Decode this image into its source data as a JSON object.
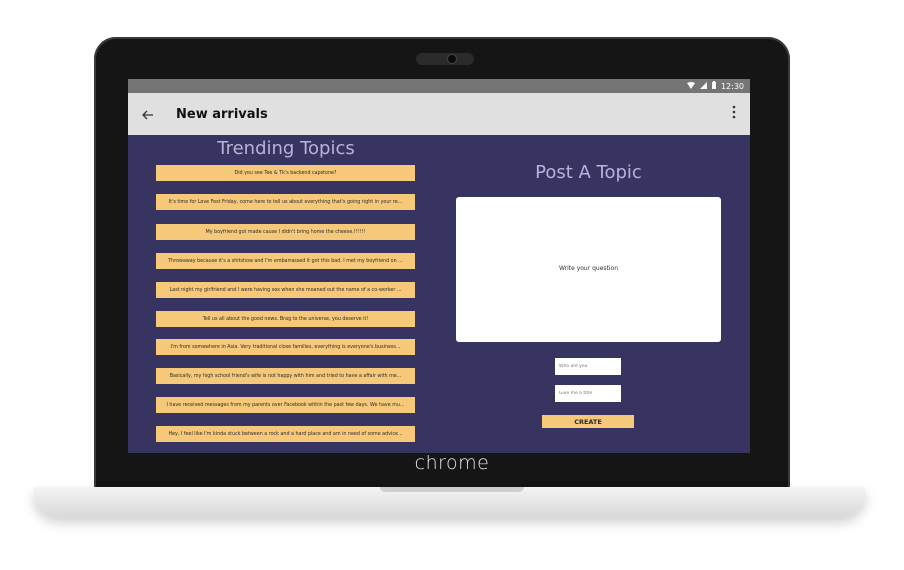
{
  "status_bar": {
    "time": "12:30"
  },
  "app_bar": {
    "title": "New arrivals"
  },
  "trending": {
    "title": "Trending Topics",
    "topics": [
      "Did you see Tee & Tk's backend capstone?",
      "It's time for Love Fest Friday, come here to tell us about everything that's going right in your re...",
      "My boyfriend got made cause I didn't bring home the cheese.!!!!!!",
      "Throwaway because it's a shitshow and I'm embarrassed it got this bad. I met my boyfriend on ...",
      "Last night my girlfriend and I were having sex when she moaned out the name of a co-worker ...",
      "Tell us all about the good news. Brag to the universe, you deserve it!",
      "I'm from somewhere in Asia. Very traditional close families, everything is everyone's business...",
      "Basically, my high school friend's wife is not happy with him and tried to have a affair with me...",
      "I have received messages from my parents over Facebook within the past few days. We have mu...",
      "Hey, I feel like I'm kinda stuck between a rock and a hard place and am in need of some advice..."
    ]
  },
  "post": {
    "title": "Post A Topic",
    "question_placeholder": "Write your question",
    "who_placeholder": "Who are you",
    "title_placeholder": "Give me a title",
    "create_label": "CREATE"
  },
  "device": {
    "brand": "chrome"
  },
  "colors": {
    "screen_bg": "#383462",
    "accent": "#f6c879",
    "heading": "#b7b4d8",
    "app_bar": "#e0e0e0"
  }
}
